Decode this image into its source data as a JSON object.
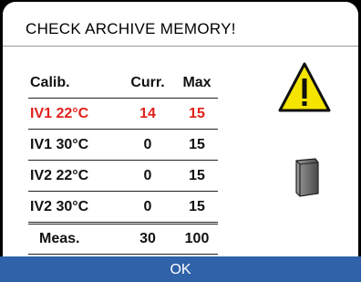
{
  "dialog": {
    "title": "CHECK ARCHIVE MEMORY!"
  },
  "table": {
    "headers": [
      "Calib.",
      "Curr.",
      "Max"
    ],
    "rows": [
      {
        "label": "IV1 22°C",
        "curr": "14",
        "max": "15",
        "status": "alert"
      },
      {
        "label": "IV1 30°C",
        "curr": "0",
        "max": "15",
        "status": "normal"
      },
      {
        "label": "IV2 22°C",
        "curr": "0",
        "max": "15",
        "status": "normal"
      },
      {
        "label": "IV2 30°C",
        "curr": "0",
        "max": "15",
        "status": "normal"
      }
    ],
    "footer": {
      "label": "Meas.",
      "curr": "30",
      "max": "100"
    }
  },
  "icons": {
    "warning": "warning-icon",
    "archive": "archive-book-icon"
  },
  "ok_button": {
    "label": "OK"
  },
  "colors": {
    "alert": "#e0201a",
    "button_bar": "#2f62a8",
    "warning_fill": "#f4e400"
  }
}
